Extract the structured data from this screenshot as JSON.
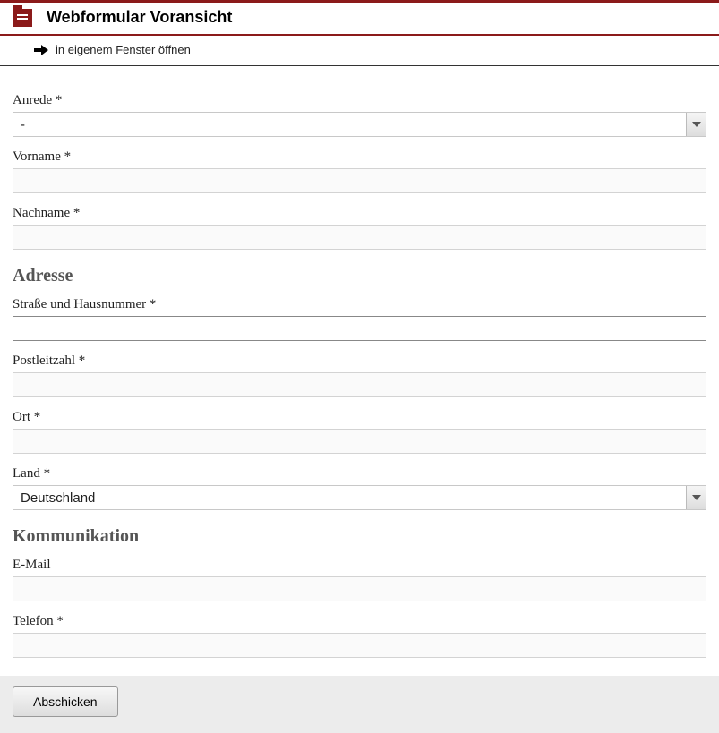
{
  "header": {
    "title": "Webformular Voransicht"
  },
  "subbar": {
    "open_new_window": "in eigenem Fenster öffnen"
  },
  "form": {
    "anrede": {
      "label": "Anrede *",
      "value": "-"
    },
    "vorname": {
      "label": "Vorname *",
      "value": ""
    },
    "nachname": {
      "label": "Nachname *",
      "value": ""
    },
    "section_adresse": "Adresse",
    "strasse": {
      "label": "Straße und Hausnummer *",
      "value": ""
    },
    "plz": {
      "label": "Postleitzahl *",
      "value": ""
    },
    "ort": {
      "label": "Ort *",
      "value": ""
    },
    "land": {
      "label": "Land *",
      "value": "Deutschland"
    },
    "section_kommunikation": "Kommunikation",
    "email": {
      "label": "E-Mail",
      "value": ""
    },
    "telefon": {
      "label": "Telefon *",
      "value": ""
    },
    "submit": "Abschicken"
  }
}
